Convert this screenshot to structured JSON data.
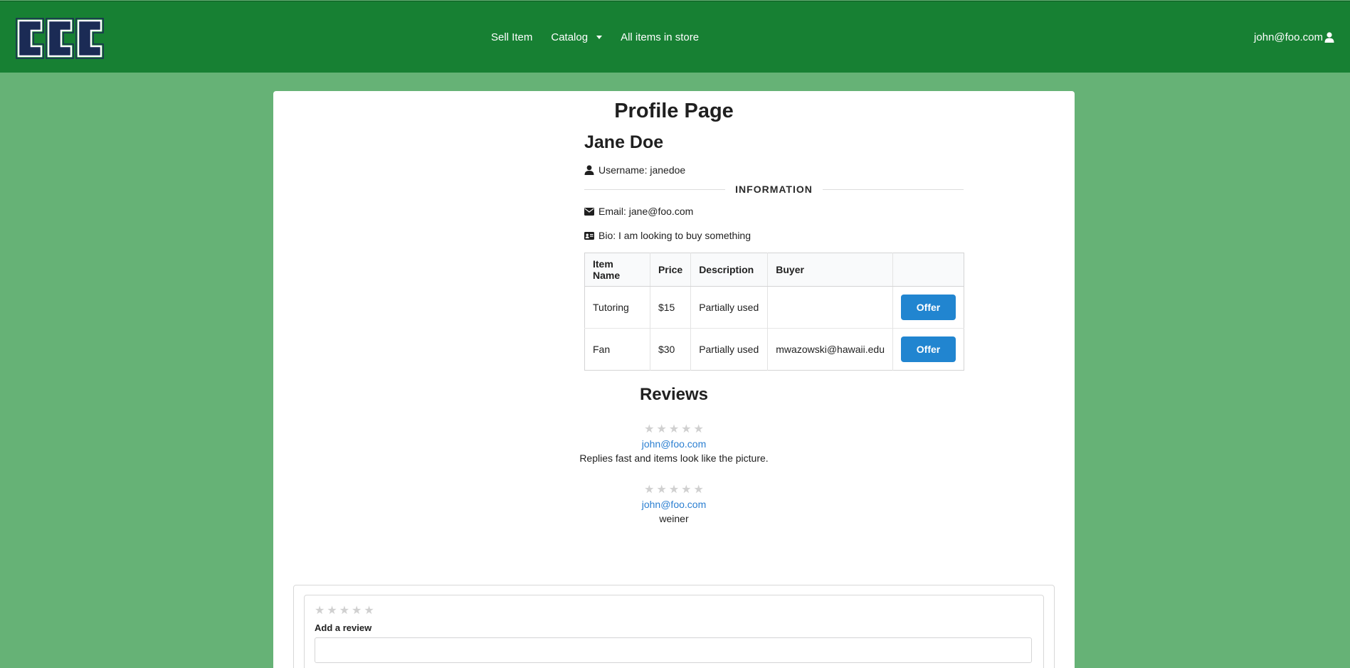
{
  "navbar": {
    "logo_text": "CCC",
    "links": [
      {
        "label": "Sell Item"
      },
      {
        "label": "Catalog"
      },
      {
        "label": "All items in store"
      }
    ],
    "user_email": "john@foo.com"
  },
  "profile": {
    "page_title": "Profile Page",
    "name": "Jane Doe",
    "username_line": "Username: janedoe",
    "divider_label": "INFORMATION",
    "email_line": "Email: jane@foo.com",
    "bio_line": "Bio: I am looking to buy something"
  },
  "items_table": {
    "headers": [
      "Item Name",
      "Price",
      "Description",
      "Buyer",
      ""
    ],
    "rows": [
      {
        "name": "Tutoring",
        "price": "$15",
        "description": "Partially used",
        "buyer": "",
        "action": "Offer"
      },
      {
        "name": "Fan",
        "price": "$30",
        "description": "Partially used",
        "buyer": "mwazowski@hawaii.edu",
        "action": "Offer"
      }
    ]
  },
  "reviews": {
    "title": "Reviews",
    "items": [
      {
        "author": "john@foo.com",
        "text": "Replies fast and items look like the picture.",
        "rating": 0
      },
      {
        "author": "john@foo.com",
        "text": "weiner",
        "rating": 0
      }
    ]
  },
  "review_form": {
    "label": "Add a review",
    "rating": 0,
    "input_value": ""
  },
  "colors": {
    "navbar": "#178033",
    "background": "#66b276",
    "button": "#2185d0",
    "link": "#2b7fd1"
  }
}
